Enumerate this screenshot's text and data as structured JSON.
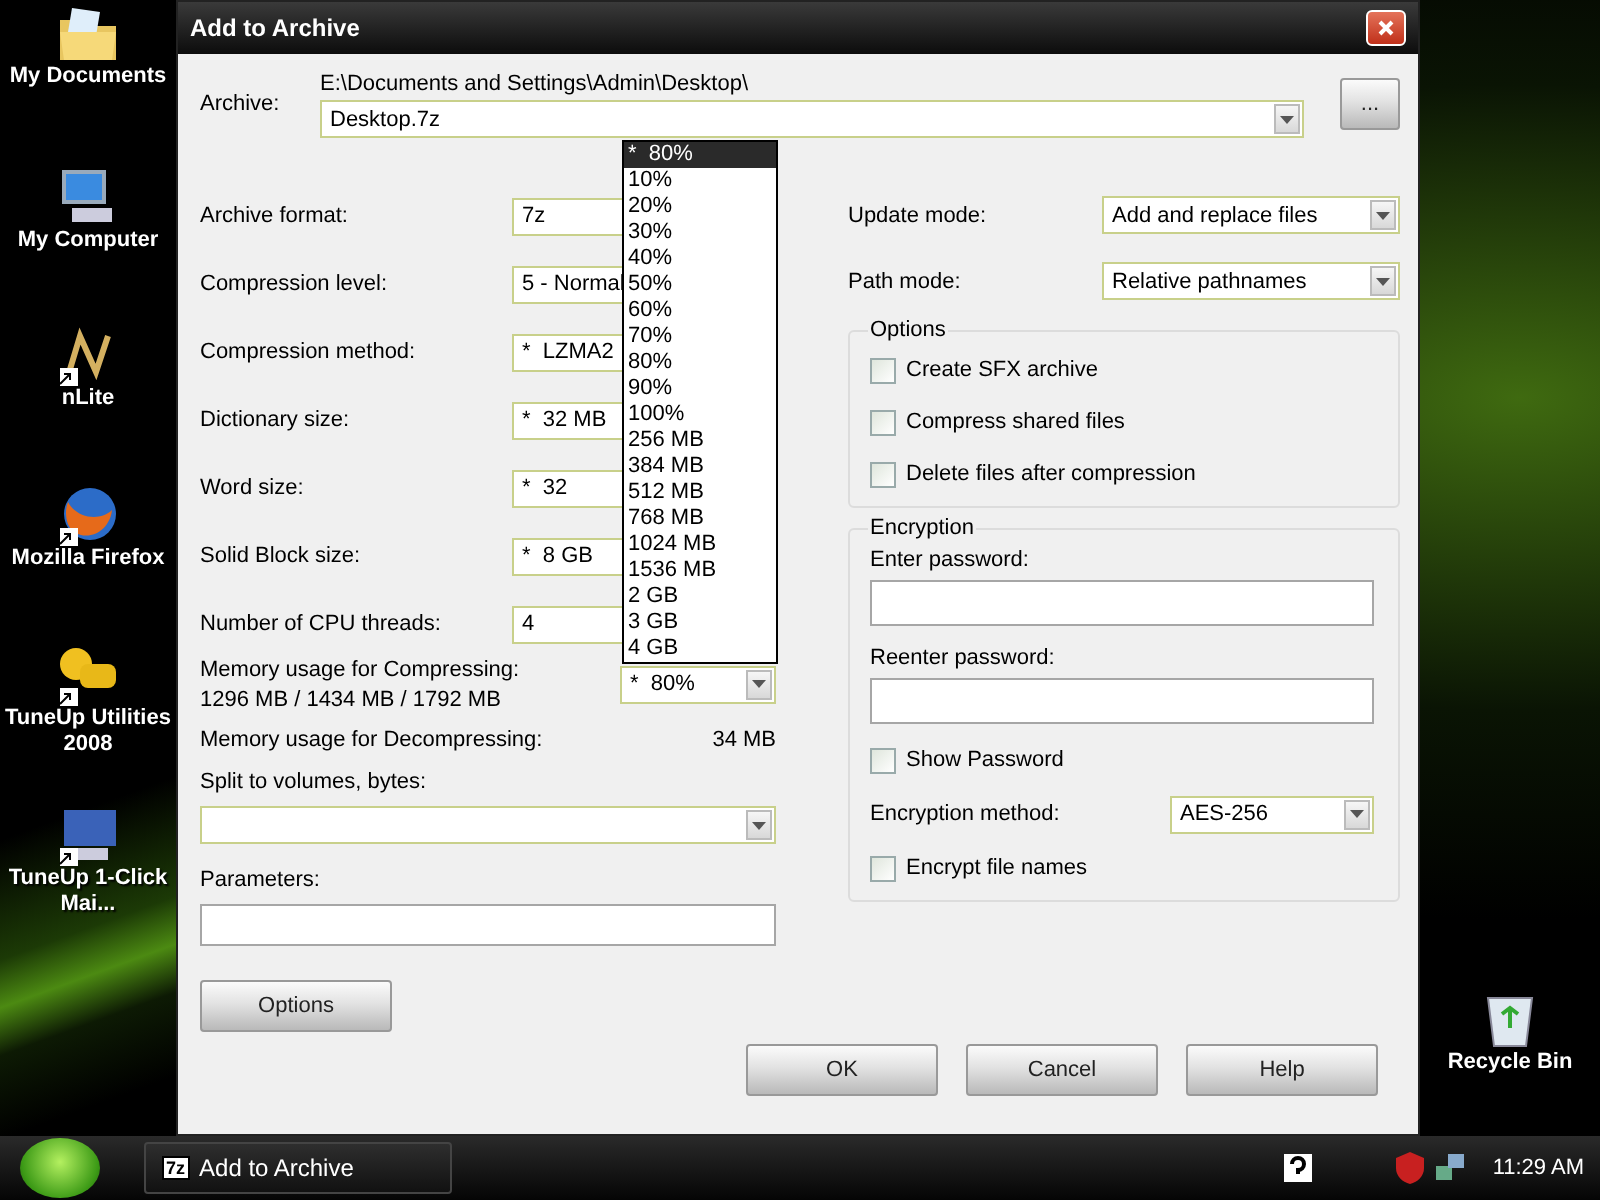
{
  "desktop_icons": [
    {
      "label": "My Documents",
      "kind": "folder",
      "shortcut": false
    },
    {
      "label": "My Computer",
      "kind": "computer",
      "shortcut": false
    },
    {
      "label": "nLite",
      "kind": "nlite",
      "shortcut": true
    },
    {
      "label": "Mozilla Firefox",
      "kind": "browser",
      "shortcut": true
    },
    {
      "label": "TuneUp Utilities 2008",
      "kind": "tools",
      "shortcut": true
    },
    {
      "label": "TuneUp 1-Click Mai...",
      "kind": "monitor",
      "shortcut": true
    }
  ],
  "recycle_bin": {
    "label": "Recycle Bin"
  },
  "window": {
    "title": "Add to Archive",
    "archive": {
      "label": "Archive:",
      "path": "E:\\Documents and Settings\\Admin\\Desktop\\",
      "value": "Desktop.7z",
      "browse": "..."
    },
    "fields": [
      {
        "label": "Archive format:",
        "value": "7z"
      },
      {
        "label": "Compression level:",
        "value": "5 - Normal"
      },
      {
        "label": "Compression method:",
        "value": "*  LZMA2"
      },
      {
        "label": "Dictionary size:",
        "value": "*  32 MB"
      },
      {
        "label": "Word size:",
        "value": "*  32"
      },
      {
        "label": "Solid Block size:",
        "value": "*  8 GB"
      },
      {
        "label": "Number of CPU threads:",
        "value": "4"
      }
    ],
    "memory": {
      "compress_label": "Memory usage for Compressing:",
      "compress_values": "1296 MB / 1434 MB / 1792 MB",
      "value": "*  80%",
      "decompress_label": "Memory usage for Decompressing:",
      "decompress_value": "34 MB"
    },
    "dropdown": [
      {
        "label": "*  80%",
        "selected": true
      },
      {
        "label": "10%",
        "selected": false
      },
      {
        "label": "20%",
        "selected": false
      },
      {
        "label": "30%",
        "selected": false
      },
      {
        "label": "40%",
        "selected": false
      },
      {
        "label": "50%",
        "selected": false
      },
      {
        "label": "60%",
        "selected": false
      },
      {
        "label": "70%",
        "selected": false
      },
      {
        "label": "80%",
        "selected": false
      },
      {
        "label": "90%",
        "selected": false
      },
      {
        "label": "100%",
        "selected": false
      },
      {
        "label": "256 MB",
        "selected": false
      },
      {
        "label": "384 MB",
        "selected": false
      },
      {
        "label": "512 MB",
        "selected": false
      },
      {
        "label": "768 MB",
        "selected": false
      },
      {
        "label": "1024 MB",
        "selected": false
      },
      {
        "label": "1536 MB",
        "selected": false
      },
      {
        "label": "2 GB",
        "selected": false
      },
      {
        "label": "3 GB",
        "selected": false
      },
      {
        "label": "4 GB",
        "selected": false
      }
    ],
    "split": {
      "label": "Split to volumes, bytes:"
    },
    "parameters": {
      "label": "Parameters:"
    },
    "options_button": "Options",
    "update_mode": {
      "label": "Update mode:",
      "value": "Add and replace files"
    },
    "path_mode": {
      "label": "Path mode:",
      "value": "Relative pathnames"
    },
    "options": {
      "title": "Options",
      "checkboxes": [
        {
          "label": "Create SFX archive",
          "checked": false
        },
        {
          "label": "Compress shared files",
          "checked": false
        },
        {
          "label": "Delete files after compression",
          "checked": false
        }
      ]
    },
    "encryption": {
      "title": "Encryption",
      "enter_label": "Enter password:",
      "reenter_label": "Reenter password:",
      "show_password": {
        "label": "Show Password",
        "checked": false
      },
      "method": {
        "label": "Encryption method:",
        "value": "AES-256"
      },
      "encrypt_names": {
        "label": "Encrypt file names",
        "checked": false
      }
    },
    "buttons": [
      "OK",
      "Cancel",
      "Help"
    ]
  },
  "taskbar": {
    "task_icon": "7z",
    "task": "Add to Archive",
    "time": "11:29 AM"
  }
}
